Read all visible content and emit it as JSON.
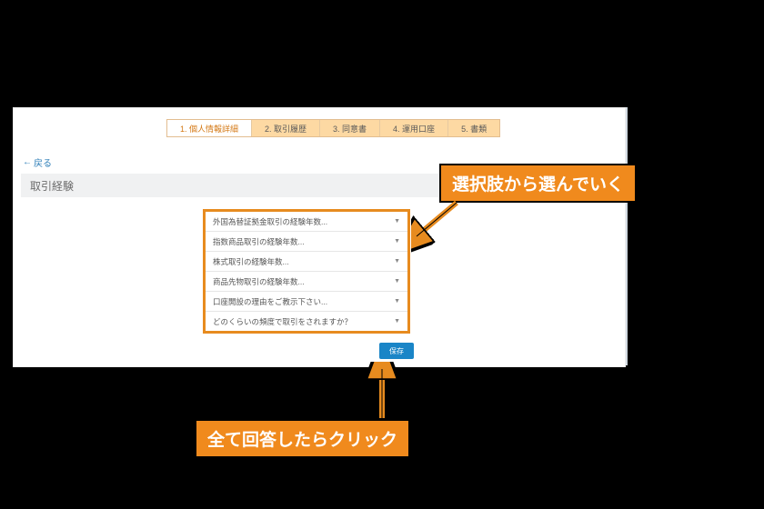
{
  "steps": {
    "items": [
      {
        "label": "1. 個人情報詳細"
      },
      {
        "label": "2. 取引履歴"
      },
      {
        "label": "3. 同意書"
      },
      {
        "label": "4. 運用口座"
      },
      {
        "label": "5. 書類"
      }
    ],
    "active_index": 0
  },
  "back": {
    "label": "戻る"
  },
  "section": {
    "title": "取引経験"
  },
  "dropdowns": {
    "items": [
      {
        "label": "外国為替証拠金取引の経験年数..."
      },
      {
        "label": "指数商品取引の経験年数..."
      },
      {
        "label": "株式取引の経験年数..."
      },
      {
        "label": "商品先物取引の経験年数..."
      },
      {
        "label": "口座開設の理由をご教示下さい..."
      },
      {
        "label": "どのくらいの頻度で取引をされますか？"
      }
    ]
  },
  "save": {
    "label": "保存"
  },
  "annotations": {
    "top": "選択肢から選んでいく",
    "bottom": "全て回答したらクリック"
  }
}
